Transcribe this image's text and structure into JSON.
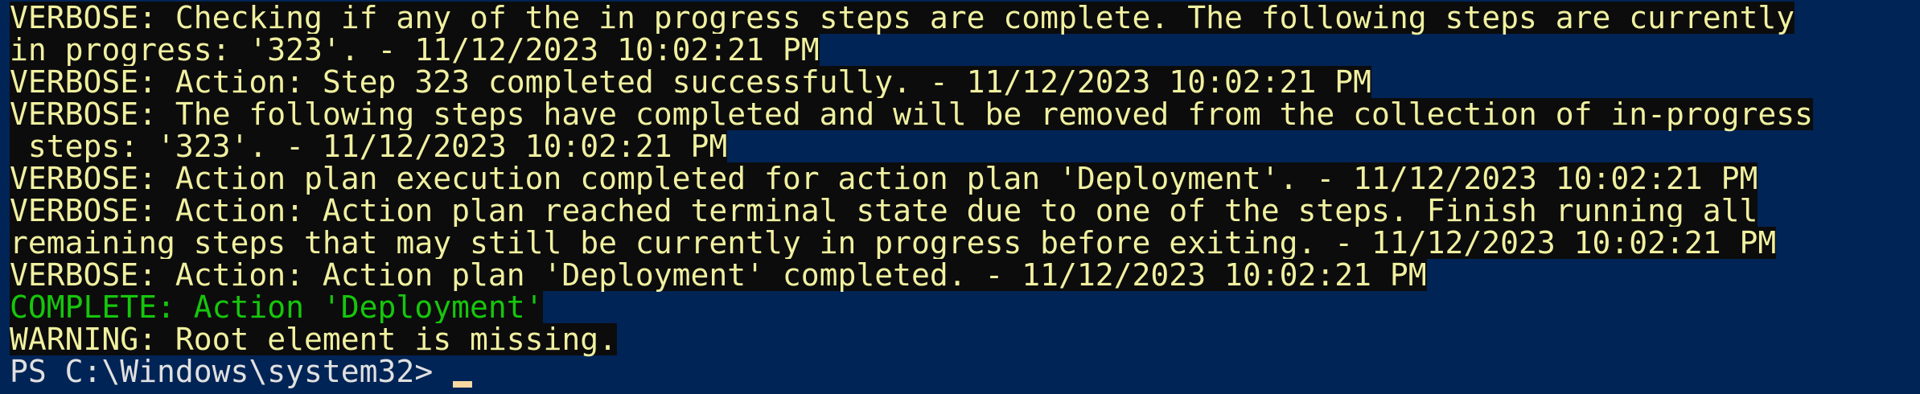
{
  "terminal": {
    "lines": [
      "VERBOSE: Checking if any of the in progress steps are complete. The following steps are currently",
      "in progress: '323'. - 11/12/2023 10:02:21 PM",
      "VERBOSE: Action: Step 323 completed successfully. - 11/12/2023 10:02:21 PM",
      "VERBOSE: The following steps have completed and will be removed from the collection of in-progress",
      " steps: '323'. - 11/12/2023 10:02:21 PM",
      "VERBOSE: Action plan execution completed for action plan 'Deployment'. - 11/12/2023 10:02:21 PM",
      "VERBOSE: Action: Action plan reached terminal state due to one of the steps. Finish running all",
      "remaining steps that may still be currently in progress before exiting. - 11/12/2023 10:02:21 PM",
      "VERBOSE: Action: Action plan 'Deployment' completed. - 11/12/2023 10:02:21 PM",
      "COMPLETE: Action 'Deployment'",
      "WARNING: Root element is missing."
    ],
    "prompt": "PS C:\\Windows\\system32> ",
    "colors": {
      "background": "#012456",
      "verbose": "#f0f0a0",
      "complete": "#16c60c",
      "text_bg": "#0c0c0c",
      "prompt": "#e0e0e0"
    }
  }
}
